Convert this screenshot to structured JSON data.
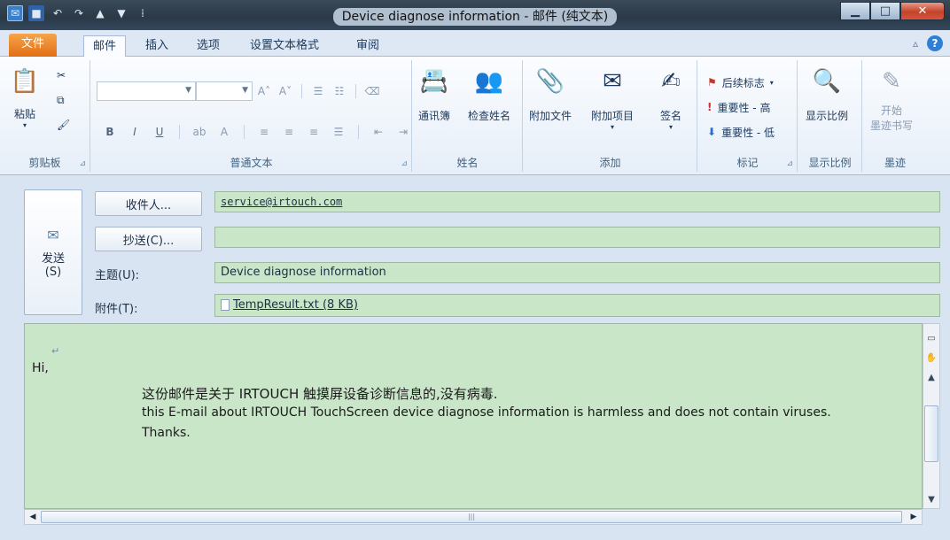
{
  "window": {
    "title": "Device diagnose information - 邮件 (纯文本)"
  },
  "tabs": [
    "文件",
    "邮件",
    "插入",
    "选项",
    "设置文本格式",
    "审阅"
  ],
  "ribbon": {
    "clipboard": {
      "paste": "粘贴",
      "label": "剪贴板"
    },
    "basic_text": {
      "label": "普通文本"
    },
    "names": {
      "address_book": "通讯簿",
      "check_names": "检查姓名",
      "label": "姓名"
    },
    "include": {
      "attach_file": "附加文件",
      "attach_item": "附加项目",
      "signature": "签名",
      "label": "添加"
    },
    "tags": {
      "follow_up": "后续标志",
      "high_importance": "重要性 - 高",
      "low_importance": "重要性 - 低",
      "label": "标记"
    },
    "zoom": {
      "zoom": "显示比例",
      "label": "显示比例"
    },
    "ink": {
      "start_inking": "开始墨迹书写",
      "start_line1": "开始",
      "start_line2": "墨迹书写",
      "label": "墨迹"
    }
  },
  "compose": {
    "send_line1": "发送",
    "send_line2": "(S)",
    "to_button": "收件人...",
    "cc_button": "抄送(C)...",
    "subject_label": "主题(U):",
    "attachment_label": "附件(T):",
    "to_value": "service@irtouch.com",
    "cc_value": "",
    "subject_value": "Device diagnose information",
    "attachment_value": "TempResult.txt (8 KB)"
  },
  "body": {
    "greeting": "Hi,",
    "line_cn": "这份邮件是关于 IRTOUCH  触摸屏设备诊断信息的,没有病毒.",
    "line_en": "this E-mail about IRTOUCH TouchScreen device diagnose information is harmless and does not contain viruses.",
    "thanks": "Thanks."
  },
  "colors": {
    "file_tab": "#e26e14",
    "field_green": "#c9e6c9",
    "close_button": "#c4432b"
  }
}
